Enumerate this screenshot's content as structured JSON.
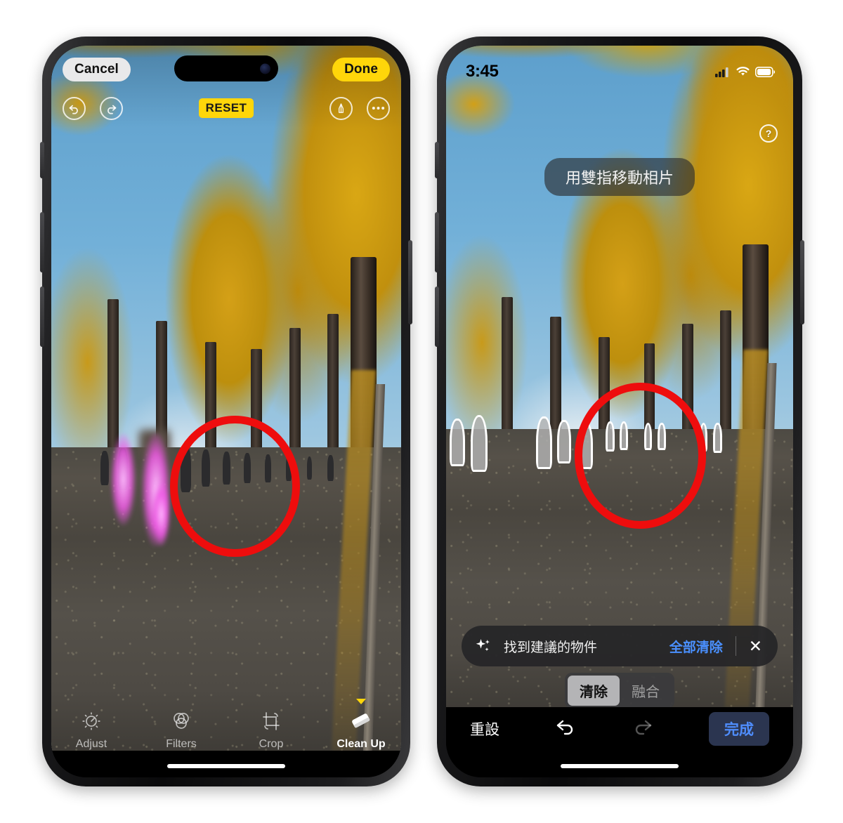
{
  "left_phone": {
    "name": "photos-editor-cleanup-before",
    "top_bar": {
      "cancel_label": "Cancel",
      "done_label": "Done"
    },
    "tool_row": {
      "undo_icon": "undo-icon",
      "redo_icon": "redo-icon",
      "reset_label": "RESET",
      "markup_icon": "markup-pen-icon",
      "more_icon": "more-ellipsis-icon"
    },
    "bottom_tools": [
      {
        "label": "Adjust",
        "icon": "adjust-dial-icon",
        "active": false
      },
      {
        "label": "Filters",
        "icon": "filters-circles-icon",
        "active": false
      },
      {
        "label": "Crop",
        "icon": "crop-icon",
        "active": false
      },
      {
        "label": "Clean Up",
        "icon": "eraser-icon",
        "active": true
      }
    ],
    "annotation": {
      "shape": "red-ellipse",
      "color": "#ee0d0d"
    },
    "brush_selection": {
      "color": "#f05ae6",
      "description": "pink clean-up brush stroke"
    }
  },
  "right_phone": {
    "name": "photos-editor-cleanup-suggestions",
    "status_bar": {
      "time": "3:45",
      "cellular_icon": "cellular-bars-icon",
      "wifi_icon": "wifi-icon",
      "battery_icon": "battery-icon"
    },
    "help_icon": "help-question-icon",
    "hint": "用雙指移動相片",
    "suggestion_bar": {
      "sparkle_icon": "sparkle-icon",
      "text": "找到建議的物件",
      "clear_all_label": "全部清除",
      "close_icon": "close-x-icon"
    },
    "mode_segments": [
      {
        "label": "清除",
        "active": true
      },
      {
        "label": "融合",
        "active": false
      }
    ],
    "bottom_bar": {
      "reset_label": "重設",
      "undo_icon": "undo-arrow-icon",
      "redo_icon": "redo-arrow-icon",
      "done_label": "完成"
    },
    "annotation": {
      "shape": "red-ellipse",
      "color": "#ee0d0d"
    },
    "detected_objects": {
      "outline_color": "#ffffff",
      "count": 11
    }
  },
  "colors": {
    "accent_yellow": "#ffd60a",
    "accent_blue": "#4a90ff",
    "annotation_red": "#ee0d0d",
    "brush_pink": "#f05ae6",
    "done_button_bg": "#2b3550",
    "page_background": "#ffffff"
  }
}
